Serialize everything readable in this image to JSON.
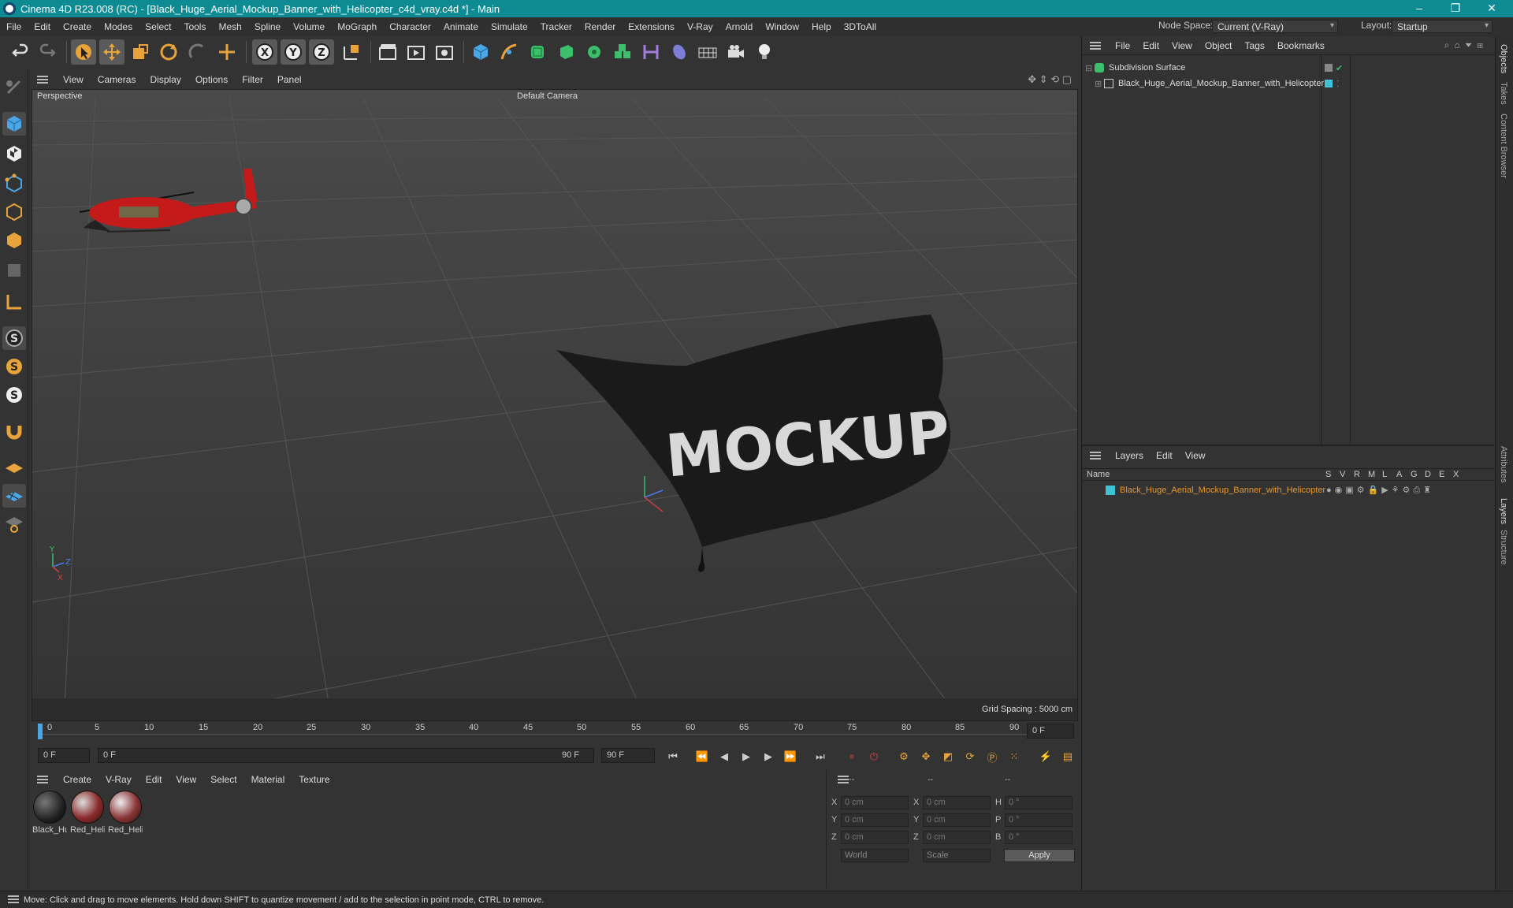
{
  "window": {
    "title": "Cinema 4D R23.008 (RC) - [Black_Huge_Aerial_Mockup_Banner_with_Helicopter_c4d_vray.c4d *] - Main",
    "controls": [
      "–",
      "❐",
      "✕"
    ]
  },
  "menubar": {
    "items": [
      "File",
      "Edit",
      "Create",
      "Modes",
      "Select",
      "Tools",
      "Mesh",
      "Spline",
      "Volume",
      "MoGraph",
      "Character",
      "Animate",
      "Simulate",
      "Tracker",
      "Render",
      "Extensions",
      "V-Ray",
      "Arnold",
      "Window",
      "Help",
      "3DToAll"
    ],
    "node_space_label": "Node Space:",
    "node_space_value": "Current (V-Ray)",
    "layout_label": "Layout:",
    "layout_value": "Startup"
  },
  "viewport": {
    "menu": [
      "View",
      "Cameras",
      "Display",
      "Options",
      "Filter",
      "Panel"
    ],
    "view_name": "Perspective",
    "camera": "Default Camera",
    "grid_spacing": "Grid Spacing : 5000 cm",
    "banner_text": "MOCKUP",
    "axis_labels": {
      "y": "Y",
      "z": "Z",
      "x": "X"
    }
  },
  "timeline": {
    "ticks": [
      "0",
      "5",
      "10",
      "15",
      "20",
      "25",
      "30",
      "35",
      "40",
      "45",
      "50",
      "55",
      "60",
      "65",
      "70",
      "75",
      "80",
      "85",
      "90"
    ],
    "current_frame_field": "0 F",
    "start_field": "0 F",
    "range_start": "0 F",
    "range_end": "90 F",
    "end_field": "90 F"
  },
  "materials": {
    "menu": [
      "Create",
      "V-Ray",
      "Edit",
      "View",
      "Select",
      "Material",
      "Texture"
    ],
    "items": [
      {
        "name": "Black_Hu",
        "color": "#222222"
      },
      {
        "name": "Red_Heli",
        "color": "#8a2a2a"
      },
      {
        "name": "Red_Heli",
        "color": "#8a3535"
      }
    ]
  },
  "coordinates": {
    "header": [
      "--",
      "--",
      "--"
    ],
    "rows": [
      {
        "a": "X",
        "av": "0 cm",
        "b": "X",
        "bv": "0 cm",
        "c": "H",
        "cv": "0 °"
      },
      {
        "a": "Y",
        "av": "0 cm",
        "b": "Y",
        "bv": "0 cm",
        "c": "P",
        "cv": "0 °"
      },
      {
        "a": "Z",
        "av": "0 cm",
        "b": "Z",
        "bv": "0 cm",
        "c": "B",
        "cv": "0 °"
      }
    ],
    "mode": "World",
    "scale": "Scale",
    "apply": "Apply"
  },
  "objects": {
    "menu": [
      "File",
      "Edit",
      "View",
      "Object",
      "Tags",
      "Bookmarks"
    ],
    "items": [
      {
        "name": "Subdivision Surface"
      },
      {
        "name": "Black_Huge_Aerial_Mockup_Banner_with_Helicopter"
      }
    ]
  },
  "layers": {
    "menu": [
      "Layers",
      "Edit",
      "View"
    ],
    "header_name": "Name",
    "header_flags": [
      "S",
      "V",
      "R",
      "M",
      "L",
      "A",
      "G",
      "D",
      "E",
      "X"
    ],
    "items": [
      {
        "name": "Black_Huge_Aerial_Mockup_Banner_with_Helicopter",
        "color": "#3ec3d6"
      }
    ]
  },
  "side_tabs": [
    "Objects",
    "Takes",
    "Content Browser",
    "Attributes",
    "Layers",
    "Structure"
  ],
  "status": "Move: Click and drag to move elements. Hold down SHIFT to quantize movement / add to the selection in point mode, CTRL to remove.",
  "colors": {
    "titlebar": "#0e8a93",
    "accent_orange": "#e8a33a",
    "selected_layer_text": "#e8962c",
    "helicopter": "#c41a1a"
  }
}
